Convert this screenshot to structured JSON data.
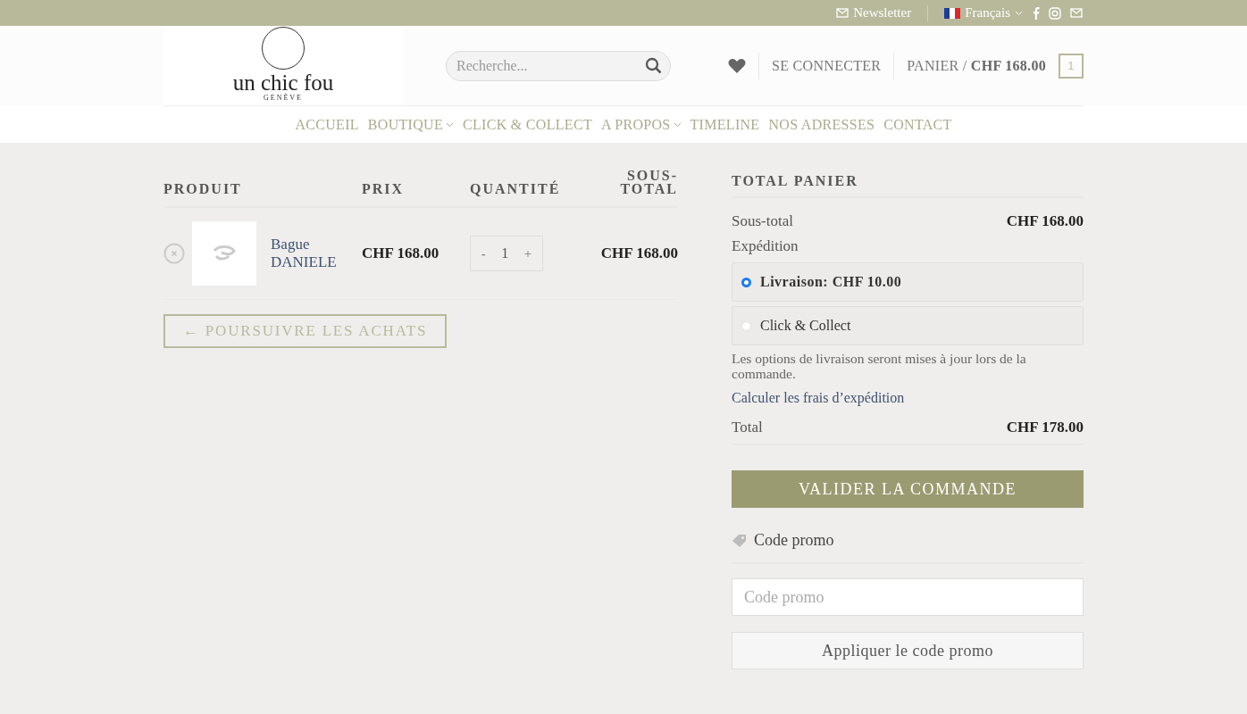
{
  "topbar": {
    "newsletter": "Newsletter",
    "language": "Français"
  },
  "header": {
    "logo": {
      "name": "un chic fou",
      "city": "GENÈVE"
    },
    "search": {
      "placeholder": "Recherche..."
    },
    "account_link": "SE CONNECTER",
    "cart": {
      "label": "PANIER /",
      "amount": "CHF 168.00",
      "count": "1"
    }
  },
  "nav": [
    {
      "label": "ACCUEIL",
      "has_dropdown": false
    },
    {
      "label": "BOUTIQUE",
      "has_dropdown": true
    },
    {
      "label": "CLICK & COLLECT",
      "has_dropdown": false
    },
    {
      "label": "A PROPOS",
      "has_dropdown": true
    },
    {
      "label": "TIMELINE",
      "has_dropdown": false
    },
    {
      "label": "NOS ADRESSES",
      "has_dropdown": false
    },
    {
      "label": "CONTACT",
      "has_dropdown": false
    }
  ],
  "cart_table": {
    "columns": [
      "PRODUIT",
      "PRIX",
      "QUANTITÉ",
      "SOUS-TOTAL"
    ],
    "rows": [
      {
        "product": "Bague DANIELE",
        "price": "CHF 168.00",
        "minus": "-",
        "quantity": "1",
        "plus": "+",
        "subtotal": "CHF 168.00"
      }
    ]
  },
  "continue_button": "← POURSUIVRE LES ACHATS",
  "totals": {
    "title": "TOTAL PANIER",
    "subtotal_label": "Sous-total",
    "subtotal": "CHF 168.00",
    "shipping_label": "Expédition",
    "shipping_options": [
      {
        "label": "Livraison:",
        "price": "CHF 10.00",
        "selected": true
      },
      {
        "label": "Click & Collect",
        "selected": false
      }
    ],
    "shipping_note": "Les options de livraison seront mises à jour lors de la commande.",
    "calc_link": "Calculer les frais d’expédition",
    "total_label": "Total",
    "total": "CHF 178.00"
  },
  "checkout_button": "VALIDER LA COMMANDE",
  "coupon": {
    "title": "Code promo",
    "placeholder": "Code promo",
    "apply": "Appliquer le code promo"
  }
}
